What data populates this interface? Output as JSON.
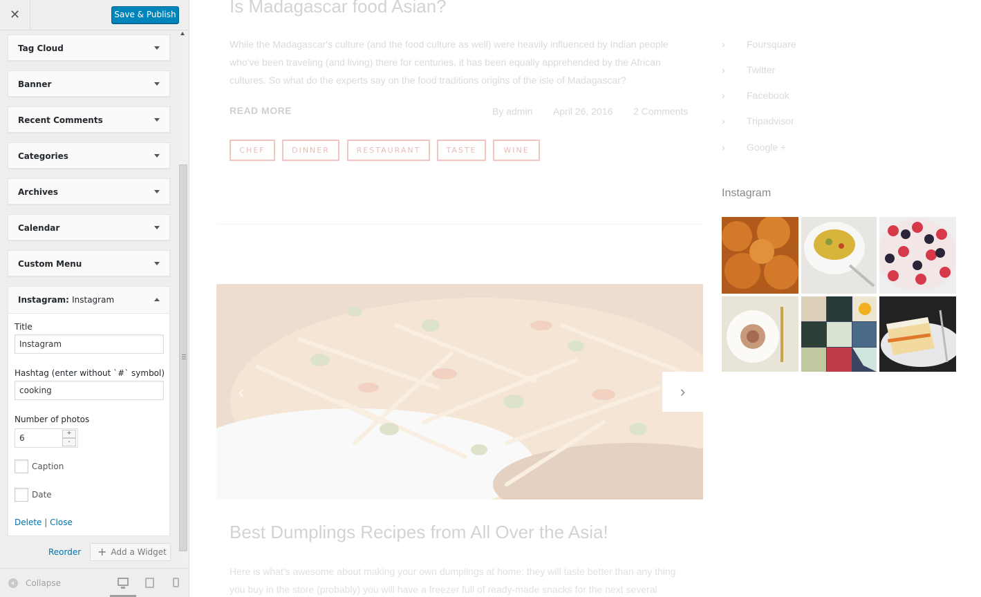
{
  "sidebar": {
    "close_glyph": "✕",
    "publish_label": "Save & Publish",
    "widgets": [
      {
        "title": "Tag Cloud"
      },
      {
        "title": "Banner"
      },
      {
        "title": "Recent Comments"
      },
      {
        "title": "Categories"
      },
      {
        "title": "Archives"
      },
      {
        "title": "Calendar"
      },
      {
        "title": "Custom Menu"
      }
    ],
    "instagram_widget": {
      "title_type": "Instagram:",
      "title_name": "Instagram",
      "fields": {
        "title_label": "Title",
        "title_value": "Instagram",
        "hashtag_label": "Hashtag (enter without `#` symbol)",
        "hashtag_value": "cooking",
        "photos_label": "Number of photos",
        "photos_value": "6",
        "caption_label": "Caption",
        "date_label": "Date",
        "caption_checked": false,
        "date_checked": false
      },
      "delete_label": "Delete",
      "separator": "|",
      "close_label": "Close"
    },
    "reorder_label": "Reorder",
    "add_widget_label": "Add a Widget",
    "footer": {
      "collapse_label": "Collapse",
      "devices": [
        "desktop-icon",
        "tablet-icon",
        "mobile-icon"
      ],
      "active_device": "desktop"
    },
    "colors": {
      "primary": "#0085ba",
      "link": "#0073aa"
    }
  },
  "preview": {
    "post1": {
      "title": "Is Madagascar food Asian?",
      "excerpt": "While the Madagascar's culture (and the food culture as well) were heavily influenced by Indian people who've been traveling (and living) there for centuries, it has been equally apprehended by the African cultures. So what do the experts say on the food traditions origins of the isle of Madagascar?",
      "read_more": "READ MORE",
      "author": "By admin",
      "date": "April 26, 2016",
      "comments": "2 Comments",
      "tags": [
        "CHEF",
        "DINNER",
        "RESTAURANT",
        "TASTE",
        "WINE"
      ]
    },
    "slider": {
      "prev_glyph": "‹",
      "next_glyph": "›"
    },
    "post2": {
      "title": "Best Dumplings Recipes from All Over the Asia!",
      "excerpt": "Here is what's awesome about making your own dumplings at home: they will taste better than any thing you buy in the store (probably) you will have a freezer full of ready-made snacks for the next several"
    },
    "social_links": [
      "Foursquare",
      "Twitter",
      "Facebook",
      "Tripadvisor",
      "Google +"
    ],
    "instagram_heading": "Instagram",
    "instagram_photos": [
      "buns",
      "rice-bowl",
      "berry-cake",
      "spaghetti",
      "sushi-collage",
      "layer-cake"
    ]
  }
}
